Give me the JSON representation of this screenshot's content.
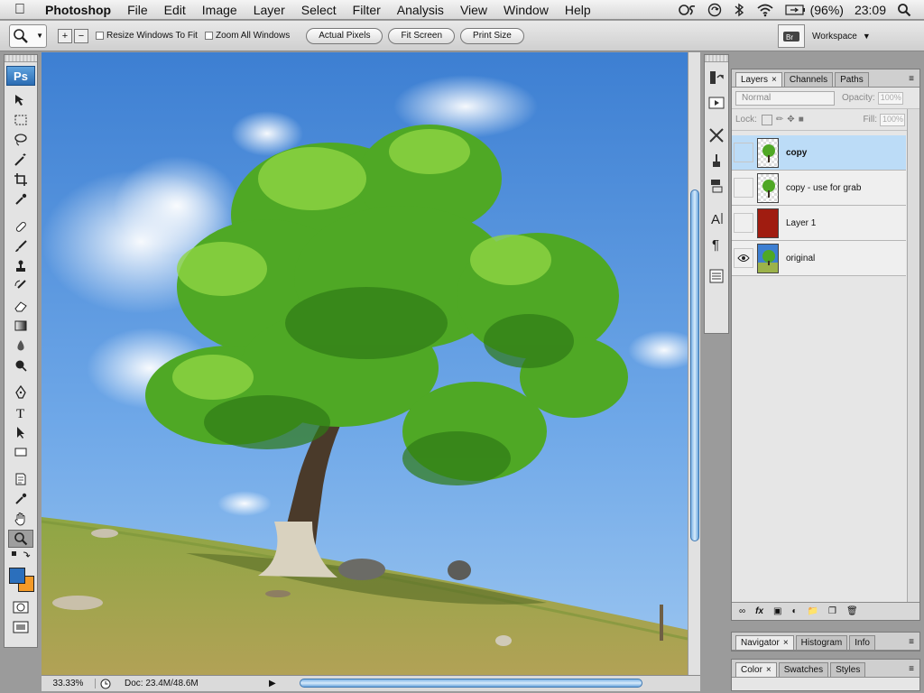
{
  "menubar": {
    "app_name": "Photoshop",
    "menus": [
      "File",
      "Edit",
      "Image",
      "Layer",
      "Select",
      "Filter",
      "Analysis",
      "View",
      "Window",
      "Help"
    ],
    "battery": "(96%)",
    "clock": "23:09"
  },
  "options_bar": {
    "resize_windows_label": "Resize Windows To Fit",
    "zoom_all_label": "Zoom All Windows",
    "actual_pixels": "Actual Pixels",
    "fit_screen": "Fit Screen",
    "print_size": "Print Size",
    "workspace": "Workspace"
  },
  "toolbox": {
    "logo": "Ps",
    "tools": [
      "move-tool-icon",
      "marquee-tool-icon",
      "lasso-tool-icon",
      "magic-wand-icon",
      "crop-tool-icon",
      "eyedropper-icon",
      "healing-brush-icon",
      "brush-icon",
      "clone-stamp-icon",
      "history-brush-icon",
      "eraser-icon",
      "gradient-icon",
      "blur-icon",
      "dodge-icon",
      "pen-tool-icon",
      "type-tool-icon",
      "path-select-icon",
      "rectangle-tool-icon",
      "notes-icon",
      "eyedropper-2-icon",
      "hand-tool-icon",
      "zoom-tool-icon"
    ],
    "fg_color": "#2b6fbc",
    "bg_color": "#f39a28"
  },
  "status": {
    "zoom": "33.33%",
    "doc": "Doc: 23.4M/48.6M"
  },
  "layers_panel": {
    "tabs": [
      "Layers",
      "Channels",
      "Paths"
    ],
    "blend_mode": "Normal",
    "opacity_label": "Opacity:",
    "opacity_value": "100%",
    "lock_label": "Lock:",
    "fill_label": "Fill:",
    "fill_value": "100%",
    "layers": [
      {
        "name": "copy",
        "selected": true,
        "visible": false
      },
      {
        "name": "copy - use for grab",
        "selected": false,
        "visible": false
      },
      {
        "name": "Layer 1",
        "selected": false,
        "visible": false
      },
      {
        "name": "original",
        "selected": false,
        "visible": true
      }
    ]
  },
  "navigator_panel": {
    "tabs": [
      "Navigator",
      "Histogram",
      "Info"
    ]
  },
  "color_panel": {
    "tabs": [
      "Color",
      "Swatches",
      "Styles"
    ]
  },
  "colors": {
    "sky_top": "#3d7fd2",
    "sky_bottom": "#8fc0f0",
    "grass": "#9cb24a",
    "foliage": "#4fa825",
    "selected_layer": "#bcdcf7",
    "layer1_fill": "#a01c10"
  }
}
